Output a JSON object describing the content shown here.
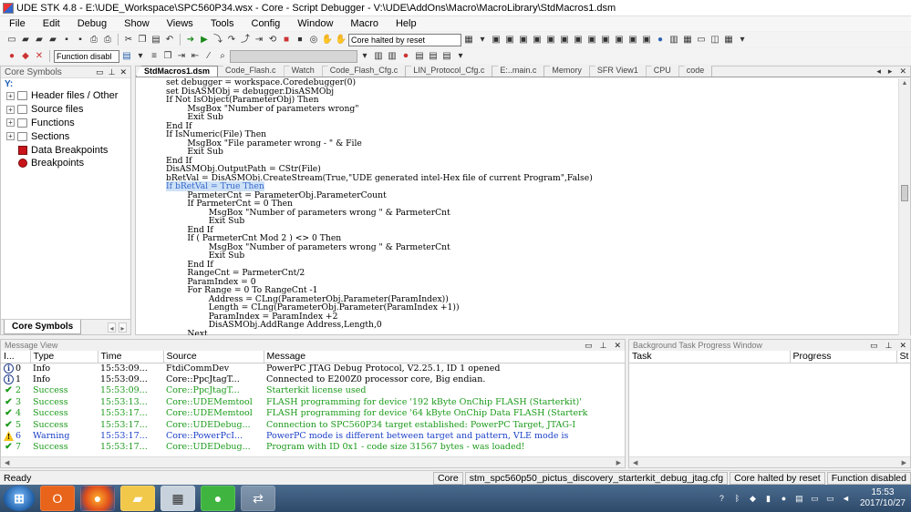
{
  "window": {
    "title": "UDE STK 4.8 - E:\\UDE_Workspace\\SPC560P34.wsx - Core - Script Debugger - V:\\UDE\\AddOns\\Macro\\MacroLibrary\\StdMacros1.dsm"
  },
  "menu": [
    "File",
    "Edit",
    "Debug",
    "Show",
    "Views",
    "Tools",
    "Config",
    "Window",
    "Macro",
    "Help"
  ],
  "toolbar": {
    "core_state": "Core halted by reset",
    "function_combo": "Function disabl"
  },
  "core_symbols": {
    "title": "Core Symbols",
    "filter": "Y:",
    "items": [
      {
        "label": "Header files / Other",
        "icon": "folder-icon"
      },
      {
        "label": "Source files",
        "icon": "folder-icon"
      },
      {
        "label": "Functions",
        "icon": "folder-icon"
      },
      {
        "label": "Sections",
        "icon": "folder-icon"
      },
      {
        "label": "Data Breakpoints",
        "icon": "data-breakpoint-icon"
      },
      {
        "label": "Breakpoints",
        "icon": "breakpoint-icon"
      }
    ],
    "tab": "Core Symbols"
  },
  "editor": {
    "tabs": [
      "StdMacros1.dsm",
      "Code_Flash.c",
      "Watch",
      "Code_Flash_Cfg.c",
      "LIN_Protocol_Cfg.c",
      "E:..main.c",
      "Memory",
      "SFR View1",
      "CPU",
      "code"
    ],
    "lines": [
      "set debugger = workspace.Coredebugger(0)",
      "set DisASMObj = debugger.DisASMObj",
      "If Not IsObject(ParameterObj) Then",
      "        MsgBox \"Number of parameters wrong\"",
      "        Exit Sub",
      "End If",
      "If IsNumeric(File) Then",
      "        MsgBox \"File parameter wrong - \" & File",
      "        Exit Sub",
      "End If",
      "DisASMObj.OutputPath = CStr(File)",
      "bRetVal = DisASMObj.CreateStream(True,\"UDE generated intel-Hex file of current Program\",False)",
      "If bRetVal = True Then",
      "        ParmeterCnt = ParameterObj.ParameterCount",
      "        If ParmeterCnt = 0 Then",
      "                MsgBox \"Number of parameters wrong \" & ParmeterCnt",
      "                Exit Sub",
      "        End If",
      "        If ( ParmeterCnt Mod 2 ) <> 0 Then",
      "                MsgBox \"Number of parameters wrong \" & ParmeterCnt",
      "                Exit Sub",
      "        End If",
      "        RangeCnt = ParmeterCnt/2",
      "        ParamIndex = 0",
      "        For Range = 0 To RangeCnt -1",
      "                Address = CLng(ParameterObj.Parameter(ParamIndex))",
      "                Length = CLng(ParameterObj.Parameter(ParamIndex +1))",
      "                ParamIndex = ParamIndex +2",
      "                DisASMObj.AddRange Address,Length,0",
      "        Next"
    ],
    "selected_line": 12
  },
  "message_view": {
    "title": "Message View",
    "columns": [
      "I...",
      "Type",
      "Time",
      "Source",
      "Message"
    ],
    "rows": [
      {
        "i": "0",
        "type": "Info",
        "time": "15:53:09...",
        "source": "FtdiCommDev",
        "message": "PowerPC JTAG Debug Protocol, V2.25.1, ID 1 opened",
        "kind": "info"
      },
      {
        "i": "1",
        "type": "Info",
        "time": "15:53:09...",
        "source": "Core::PpcJtagT...",
        "message": "Connected to E200Z0 processor core, Big endian.",
        "kind": "info"
      },
      {
        "i": "2",
        "type": "Success",
        "time": "15:53:09...",
        "source": "Core::PpcJtagT...",
        "message": "Starterkit license used",
        "kind": "success"
      },
      {
        "i": "3",
        "type": "Success",
        "time": "15:53:13...",
        "source": "Core::UDEMemtool",
        "message": "FLASH programming for device '192 kByte OnChip FLASH (Starterkit)'",
        "kind": "success"
      },
      {
        "i": "4",
        "type": "Success",
        "time": "15:53:17...",
        "source": "Core::UDEMemtool",
        "message": "FLASH programming for device '64 kByte OnChip Data FLASH (Starterk",
        "kind": "success"
      },
      {
        "i": "5",
        "type": "Success",
        "time": "15:53:17...",
        "source": "Core::UDEDebug...",
        "message": "Connection to SPC560P34 target established: PowerPC Target, JTAG-I",
        "kind": "success"
      },
      {
        "i": "6",
        "type": "Warning",
        "time": "15:53:17...",
        "source": "Core::PowerPcI...",
        "message": "PowerPC mode is different between target and pattern, VLE mode is",
        "kind": "warning"
      },
      {
        "i": "7",
        "type": "Success",
        "time": "15:53:17...",
        "source": "Core::UDEDebug...",
        "message": "Program with ID 0x1 - code size 31567 bytes - was loaded!",
        "kind": "success"
      }
    ]
  },
  "bg_tasks": {
    "title": "Background Task Progress Window",
    "columns": [
      "Task",
      "Progress",
      "St"
    ]
  },
  "status": {
    "ready": "Ready",
    "core": "Core",
    "config": "stm_spc560p50_pictus_discovery_starterkit_debug_jtag.cfg",
    "state": "Core halted by reset",
    "func": "Function disabled"
  },
  "taskbar": {
    "time": "15:53",
    "date": "2017/10/27",
    "apps": [
      "office",
      "firefox",
      "explorer",
      "calculator",
      "wechat",
      "ude"
    ]
  },
  "colors": {
    "success": "#1a9a1a",
    "warning": "#1a3fc6",
    "selection": "#cde1f7"
  }
}
